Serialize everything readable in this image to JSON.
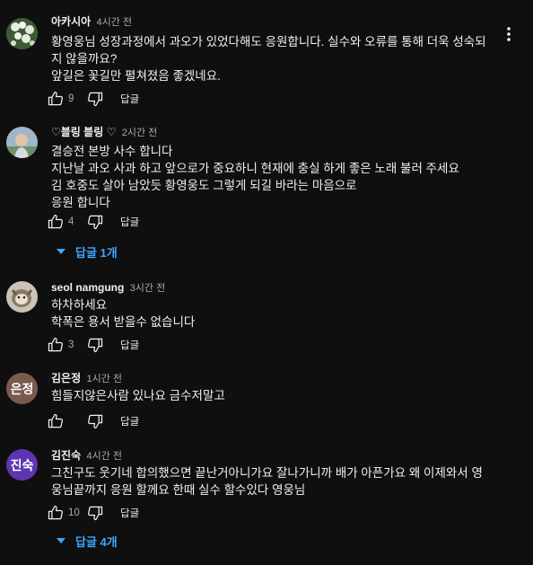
{
  "comments": [
    {
      "author": "아카시아",
      "time": "4시간 전",
      "lines": [
        "황영웅님 성장과정에서 과오가 있었다해도 응원합니다. 실수와 오류를 통해 더욱 성숙되",
        "지 않을까요?",
        "앞길은 꽃길만 펼쳐졌음 좋겠네요."
      ],
      "likes": "9",
      "reply_label": "답글",
      "avatar": "photo-flowers"
    },
    {
      "author": "♡블링 블링 ♡",
      "time": "2시간 전",
      "lines": [
        "결승전 본방  사수  합니다",
        "지난날  과오 사과 하고  앞으로가  중요하니  현재에  충실  하게  좋은 노래  불러 주세요",
        "김 호중도  살아 남았듯  황영웅도   그렇게 되길   바라는  마음으로",
        "응원  합니다"
      ],
      "likes": "4",
      "reply_label": "답글",
      "replies_toggle": "답글 1개",
      "avatar": "photo-portrait"
    },
    {
      "author": "seol namgung",
      "time": "3시간 전",
      "lines": [
        "하차하세요",
        "학폭은 용서 받을수 없습니다"
      ],
      "likes": "3",
      "reply_label": "답글",
      "avatar": "photo-animal"
    },
    {
      "author": "김은정",
      "time": "1시간 전",
      "lines": [
        "힘들지않은사람 있나요 금수저말고"
      ],
      "likes": "",
      "reply_label": "답글",
      "avatar_text": "은정",
      "avatar_color": "#7b5a4e"
    },
    {
      "author": "김진숙",
      "time": "4시간 전",
      "lines": [
        "그친구도 웃기네 합의했으면 끝난거아니가요  잘나가니까 배가 아픈가요 왜 이제와서 영",
        "웅님끝까지 응원 할께요 한때 실수 할수있다 영웅님"
      ],
      "likes": "10",
      "reply_label": "답글",
      "replies_toggle": "답글 4개",
      "avatar_text": "진숙",
      "avatar_color": "#5e35b1"
    }
  ],
  "menu_icon": "more-vert-icon",
  "colors": {
    "background": "#0f0f0f",
    "link": "#3ea6ff",
    "muted": "#aaaaaa"
  }
}
